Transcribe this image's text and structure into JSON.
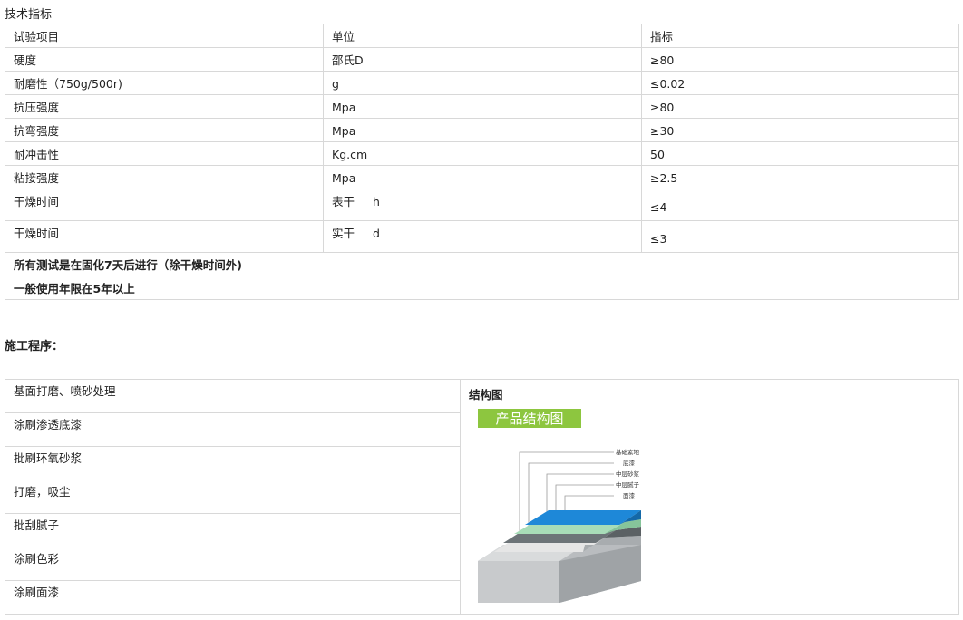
{
  "spec": {
    "title": "技术指标",
    "header": [
      "试验项目",
      "单位",
      "指标"
    ],
    "rows": [
      [
        "硬度",
        "邵氏D",
        "≥80"
      ],
      [
        "耐磨性（750g/500r)",
        "g",
        "≤0.02"
      ],
      [
        "抗压强度",
        "Mpa",
        "≥80"
      ],
      [
        "抗弯强度",
        "Mpa",
        "≥30"
      ],
      [
        "耐冲击性",
        "Kg.cm",
        "50"
      ],
      [
        "粘接强度",
        "Mpa",
        "≥2.5"
      ]
    ],
    "drying_rows": [
      {
        "item": "干燥时间",
        "unit_a": "表干",
        "unit_b": "h",
        "value": "≤4"
      },
      {
        "item": "干燥时间",
        "unit_a": "实干",
        "unit_b": "d",
        "value": "≤3"
      }
    ],
    "notes": [
      "所有测试是在固化7天后进行（除干燥时间外)",
      "一般使用年限在5年以上"
    ]
  },
  "procedure": {
    "title": "施工程序：",
    "steps": [
      "基面打磨、喷砂处理",
      "涂刷渗透底漆",
      "批刷环氧砂浆",
      "打磨，吸尘",
      "批刮腻子",
      "涂刷色彩",
      "涂刷面漆"
    ],
    "diagram_label": "结构图",
    "diagram": {
      "banner": "产品结构图",
      "banner_color": "#8dc63f",
      "layers": [
        "基础素地",
        "底漆",
        "中层砂浆",
        "中层腻子",
        "面漆"
      ],
      "top_color": "#1e88d8"
    }
  }
}
